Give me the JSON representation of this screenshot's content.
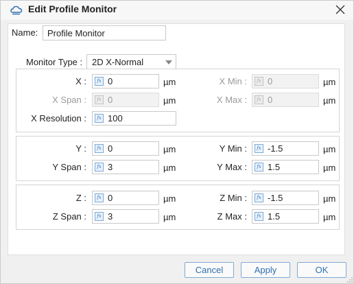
{
  "window": {
    "title": "Edit Profile Monitor"
  },
  "name": {
    "label": "Name:",
    "value": "Profile Monitor"
  },
  "monitor_type": {
    "label": "Monitor Type :",
    "value": "2D X-Normal"
  },
  "x_group": {
    "x": {
      "label": "X :",
      "value": "0",
      "unit": "µm"
    },
    "x_min": {
      "label": "X Min :",
      "value": "0",
      "unit": "µm"
    },
    "x_span": {
      "label": "X Span :",
      "value": "0",
      "unit": "µm"
    },
    "x_max": {
      "label": "X Max :",
      "value": "0",
      "unit": "µm"
    },
    "x_resolution": {
      "label": "X Resolution :",
      "value": "100"
    }
  },
  "y_group": {
    "y": {
      "label": "Y :",
      "value": "0",
      "unit": "µm"
    },
    "y_min": {
      "label": "Y Min :",
      "value": "-1.5",
      "unit": "µm"
    },
    "y_span": {
      "label": "Y Span :",
      "value": "3",
      "unit": "µm"
    },
    "y_max": {
      "label": "Y Max :",
      "value": "1.5",
      "unit": "µm"
    }
  },
  "z_group": {
    "z": {
      "label": "Z :",
      "value": "0",
      "unit": "µm"
    },
    "z_min": {
      "label": "Z Min :",
      "value": "-1.5",
      "unit": "µm"
    },
    "z_span": {
      "label": "Z Span :",
      "value": "3",
      "unit": "µm"
    },
    "z_max": {
      "label": "Z Max :",
      "value": "1.5",
      "unit": "µm"
    }
  },
  "fx_glyph": "fx",
  "buttons": {
    "cancel": "Cancel",
    "apply": "Apply",
    "ok": "OK"
  },
  "colors": {
    "accent": "#2f6db0",
    "button_border": "#7fa9d6",
    "icon_blue": "#3a74b8"
  },
  "icons": {
    "app": "cloud-icon",
    "close": "close-icon",
    "formula": "fx-icon",
    "dropdown": "chevron-down-icon",
    "resize": "resize-grip-icon"
  }
}
